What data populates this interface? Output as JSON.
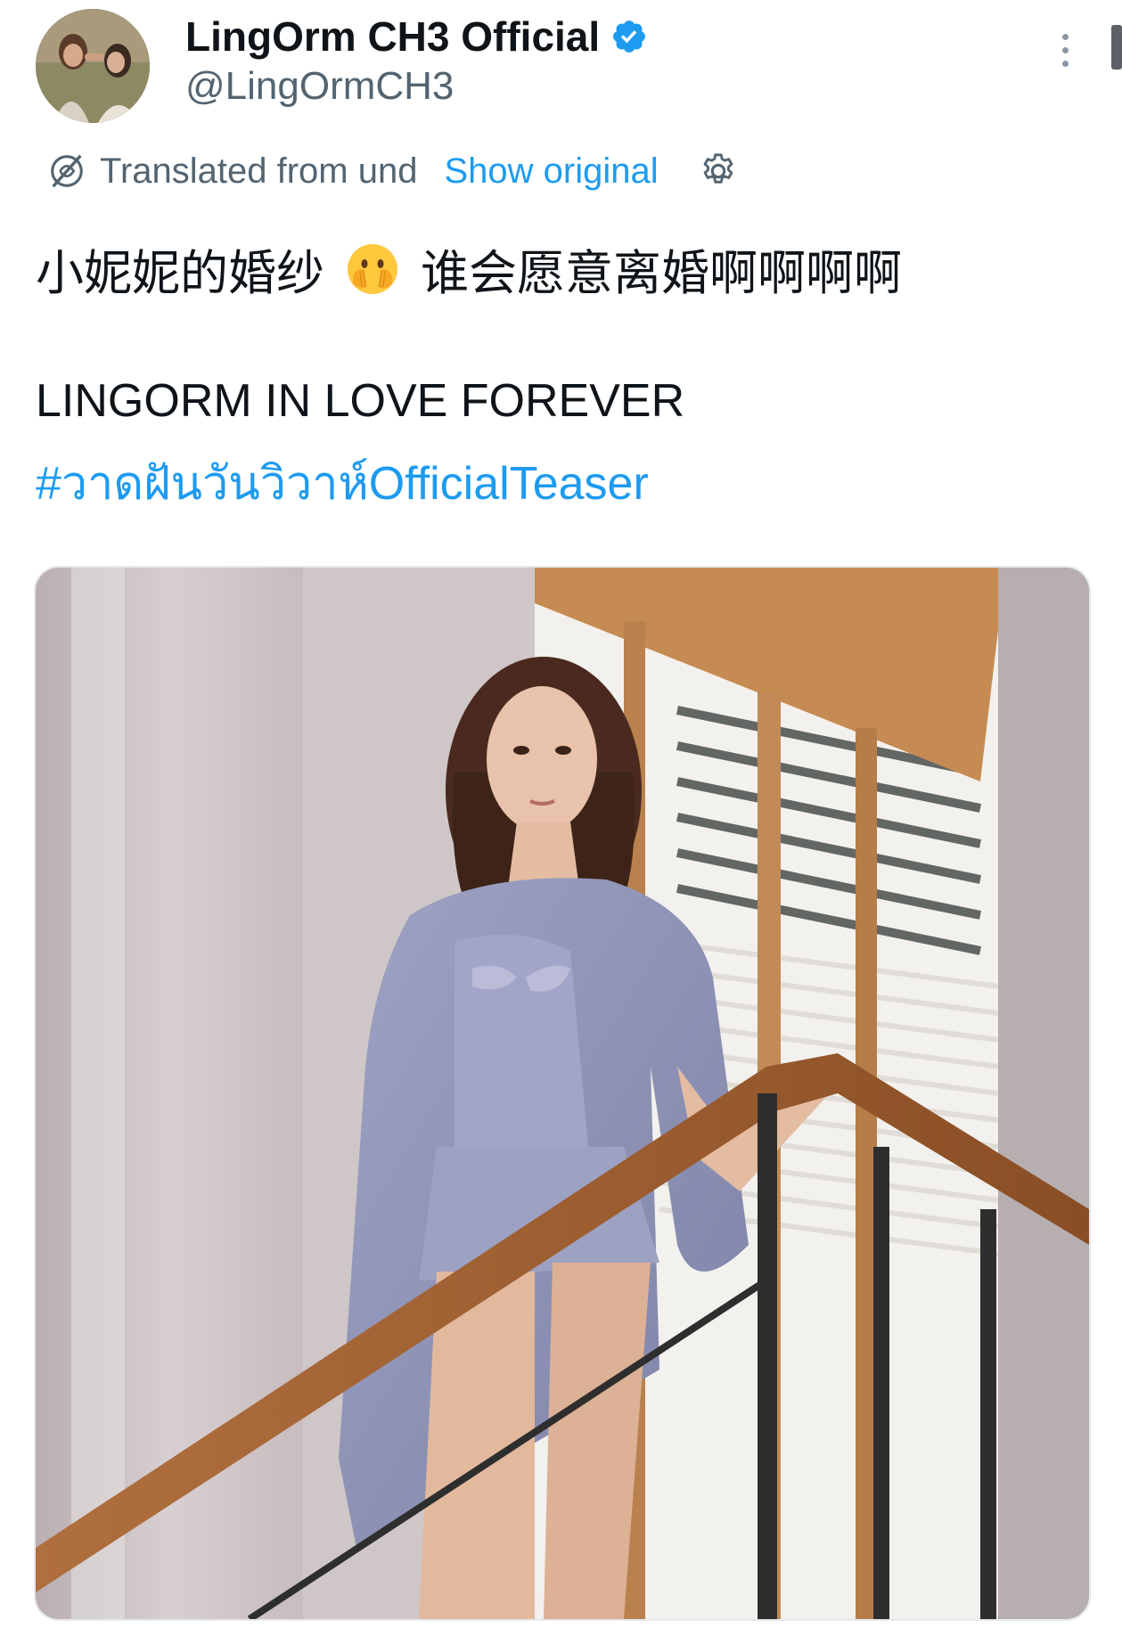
{
  "author": {
    "display_name": "LingOrm CH3 Official",
    "handle": "@LingOrmCH3",
    "verified_icon": "verified-badge-icon",
    "avatar_icon": "profile-avatar"
  },
  "translation": {
    "label": "Translated from und",
    "show_original": "Show original",
    "globe_icon": "translate-globe-icon",
    "settings_icon": "gear-icon"
  },
  "tweet": {
    "line1_before_emoji": "小妮妮的婚纱",
    "emoji": "face-with-open-eyes-and-hand-over-mouth",
    "line1_after_emoji": "谁会愿意离婚啊啊啊啊",
    "line2": "LINGORM IN LOVE FOREVER",
    "hashtag": "#วาดฝันวันวิวาห์OfficialTeaser"
  },
  "media": {
    "type": "photo"
  },
  "colors": {
    "link": "#1d9bf0",
    "secondary_text": "#536471",
    "primary_text": "#0f1419",
    "verified": "#1d9bf0"
  }
}
